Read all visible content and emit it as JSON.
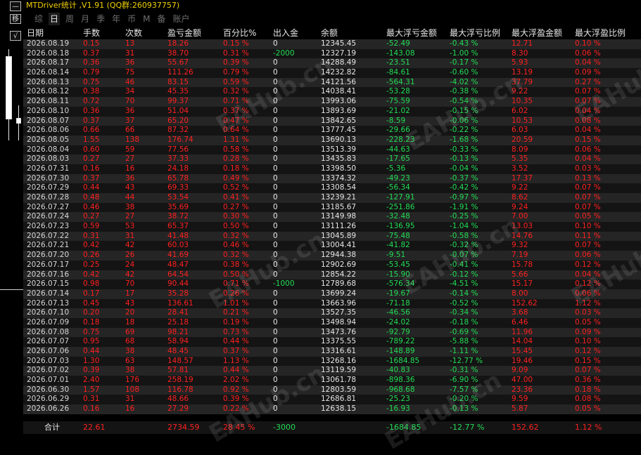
{
  "app": {
    "title": "MTDriver统计 ,V1.91 (QQ群:260937757)",
    "side_buttons": [
      "—",
      "移",
      "√"
    ]
  },
  "tabs": [
    "综",
    "日",
    "周",
    "月",
    "季",
    "年",
    "币",
    "M",
    "备",
    "账户"
  ],
  "active_tab_index": 1,
  "table": {
    "headers": [
      "日期",
      "手数",
      "次数",
      "盈亏金额",
      "百分比%",
      "出入金",
      "余额",
      "最大浮亏金额",
      "最大浮亏比例",
      "最大浮盈金额",
      "最大浮盈比例"
    ],
    "rows": [
      [
        "2026.08.19",
        "0.15",
        "13",
        "18.26",
        "0.15 %",
        "0",
        "12345.45",
        "-52.49",
        "-0.43 %",
        "12.71",
        "0.10 %"
      ],
      [
        "2026.08.18",
        "0.37",
        "31",
        "38.70",
        "0.31 %",
        "-2000",
        "12327.19",
        "-143.08",
        "-1.00 %",
        "8.30",
        "0.06 %"
      ],
      [
        "2026.08.17",
        "0.36",
        "36",
        "55.67",
        "0.39 %",
        "0",
        "14288.49",
        "-23.51",
        "-0.17 %",
        "5.93",
        "0.04 %"
      ],
      [
        "2026.08.14",
        "0.79",
        "75",
        "111.26",
        "0.79 %",
        "0",
        "14232.82",
        "-84.61",
        "-0.60 %",
        "13.19",
        "0.09 %"
      ],
      [
        "2026.08.13",
        "0.75",
        "46",
        "83.15",
        "0.59 %",
        "0",
        "14121.56",
        "-564.31",
        "-4.02 %",
        "37.79",
        "0.27 %"
      ],
      [
        "2026.08.12",
        "0.38",
        "34",
        "45.35",
        "0.32 %",
        "0",
        "14038.41",
        "-53.28",
        "-0.38 %",
        "9.22",
        "0.07 %"
      ],
      [
        "2026.08.11",
        "0.72",
        "70",
        "99.37",
        "0.71 %",
        "0",
        "13993.06",
        "-75.59",
        "-0.54 %",
        "10.35",
        "0.07 %"
      ],
      [
        "2026.08.10",
        "0.36",
        "36",
        "51.04",
        "0.37 %",
        "0",
        "13893.69",
        "-21.02",
        "-0.15 %",
        "6.02",
        "0.04 %"
      ],
      [
        "2026.08.07",
        "0.37",
        "37",
        "65.20",
        "0.47 %",
        "0",
        "13842.65",
        "-8.59",
        "-0.06 %",
        "10.53",
        "0.08 %"
      ],
      [
        "2026.08.06",
        "0.66",
        "66",
        "87.32",
        "0.64 %",
        "0",
        "13777.45",
        "-29.66",
        "-0.22 %",
        "6.03",
        "0.04 %"
      ],
      [
        "2026.08.05",
        "1.55",
        "138",
        "176.74",
        "1.31 %",
        "0",
        "13690.13",
        "-228.23",
        "-1.68 %",
        "20.59",
        "0.15 %"
      ],
      [
        "2026.08.04",
        "0.60",
        "59",
        "77.56",
        "0.58 %",
        "0",
        "13513.39",
        "-44.63",
        "-0.33 %",
        "8.09",
        "0.06 %"
      ],
      [
        "2026.08.03",
        "0.27",
        "27",
        "37.33",
        "0.28 %",
        "0",
        "13435.83",
        "-17.65",
        "-0.13 %",
        "5.35",
        "0.04 %"
      ],
      [
        "2026.07.31",
        "0.16",
        "16",
        "24.18",
        "0.18 %",
        "0",
        "13398.50",
        "-5.36",
        "-0.04 %",
        "3.52",
        "0.03 %"
      ],
      [
        "2026.07.30",
        "0.37",
        "36",
        "65.78",
        "0.49 %",
        "0",
        "13374.32",
        "-49.23",
        "-0.37 %",
        "17.37",
        "0.13 %"
      ],
      [
        "2026.07.29",
        "0.44",
        "43",
        "69.33",
        "0.52 %",
        "0",
        "13308.54",
        "-56.34",
        "-0.42 %",
        "9.22",
        "0.07 %"
      ],
      [
        "2026.07.28",
        "0.48",
        "44",
        "53.54",
        "0.41 %",
        "0",
        "13239.21",
        "-127.91",
        "-0.97 %",
        "8.62",
        "0.07 %"
      ],
      [
        "2026.07.27",
        "0.46",
        "38",
        "35.69",
        "0.27 %",
        "0",
        "13185.67",
        "-251.86",
        "-1.91 %",
        "9.24",
        "0.07 %"
      ],
      [
        "2026.07.24",
        "0.27",
        "27",
        "38.72",
        "0.30 %",
        "0",
        "13149.98",
        "-32.48",
        "-0.25 %",
        "7.00",
        "0.05 %"
      ],
      [
        "2026.07.23",
        "0.59",
        "53",
        "65.37",
        "0.50 %",
        "0",
        "13111.26",
        "-136.95",
        "-1.04 %",
        "13.03",
        "0.10 %"
      ],
      [
        "2026.07.22",
        "0.31",
        "31",
        "41.48",
        "0.32 %",
        "0",
        "13045.89",
        "-75.48",
        "-0.58 %",
        "14.76",
        "0.11 %"
      ],
      [
        "2026.07.21",
        "0.42",
        "42",
        "60.03",
        "0.46 %",
        "0",
        "13004.41",
        "-41.82",
        "-0.32 %",
        "9.32",
        "0.07 %"
      ],
      [
        "2026.07.20",
        "0.26",
        "26",
        "41.69",
        "0.32 %",
        "0",
        "12944.38",
        "-9.51",
        "-0.07 %",
        "7.19",
        "0.06 %"
      ],
      [
        "2026.07.17",
        "0.25",
        "24",
        "48.47",
        "0.38 %",
        "0",
        "12902.69",
        "-53.45",
        "-0.41 %",
        "15.78",
        "0.12 %"
      ],
      [
        "2026.07.16",
        "0.42",
        "42",
        "64.54",
        "0.50 %",
        "0",
        "12854.22",
        "-15.90",
        "-0.12 %",
        "5.66",
        "0.04 %"
      ],
      [
        "2026.07.15",
        "0.98",
        "70",
        "90.44",
        "0.71 %",
        "-1000",
        "12789.68",
        "-576.34",
        "-4.51 %",
        "15.17",
        "0.12 %"
      ],
      [
        "2026.07.14",
        "0.17",
        "17",
        "35.28",
        "0.26 %",
        "0",
        "13699.24",
        "-19.67",
        "-0.14 %",
        "8.00",
        "0.06 %"
      ],
      [
        "2026.07.13",
        "0.45",
        "43",
        "136.61",
        "1.01 %",
        "0",
        "13663.96",
        "-71.18",
        "-0.52 %",
        "152.62",
        "1.12 %"
      ],
      [
        "2026.07.10",
        "0.20",
        "20",
        "28.41",
        "0.21 %",
        "0",
        "13527.35",
        "-46.56",
        "-0.34 %",
        "3.68",
        "0.03 %"
      ],
      [
        "2026.07.09",
        "0.18",
        "18",
        "25.18",
        "0.19 %",
        "0",
        "13498.94",
        "-24.02",
        "-0.18 %",
        "6.46",
        "0.05 %"
      ],
      [
        "2026.07.08",
        "0.75",
        "69",
        "98.21",
        "0.73 %",
        "0",
        "13473.76",
        "-92.79",
        "-0.69 %",
        "11.96",
        "0.09 %"
      ],
      [
        "2026.07.07",
        "0.95",
        "68",
        "58.94",
        "0.44 %",
        "0",
        "13375.55",
        "-789.22",
        "-5.88 %",
        "14.04",
        "0.10 %"
      ],
      [
        "2026.07.06",
        "0.44",
        "38",
        "48.45",
        "0.37 %",
        "0",
        "13316.61",
        "-148.89",
        "-1.11 %",
        "15.45",
        "0.12 %"
      ],
      [
        "2026.07.03",
        "1.30",
        "63",
        "148.57",
        "1.13 %",
        "0",
        "13268.16",
        "-1684.85",
        "-12.77 %",
        "19.46",
        "0.15 %"
      ],
      [
        "2026.07.02",
        "0.39",
        "38",
        "57.81",
        "0.44 %",
        "0",
        "13119.59",
        "-40.83",
        "-0.31 %",
        "9.09",
        "0.07 %"
      ],
      [
        "2026.07.01",
        "2.40",
        "176",
        "258.19",
        "2.02 %",
        "0",
        "13061.78",
        "-898.36",
        "-6.90 %",
        "47.00",
        "0.36 %"
      ],
      [
        "2026.06.30",
        "1.57",
        "108",
        "116.78",
        "0.92 %",
        "0",
        "12803.59",
        "-968.68",
        "-7.57 %",
        "23.36",
        "0.18 %"
      ],
      [
        "2026.06.29",
        "0.31",
        "31",
        "48.66",
        "0.39 %",
        "0",
        "12686.81",
        "-25.23",
        "-0.20 %",
        "9.59",
        "0.08 %"
      ],
      [
        "2026.06.26",
        "0.16",
        "16",
        "27.29",
        "0.22 %",
        "0",
        "12638.15",
        "-16.93",
        "-0.13 %",
        "5.87",
        "0.05 %"
      ]
    ],
    "total": [
      "合计",
      "22.61",
      "",
      "2734.59",
      "28.45 %",
      "-3000",
      "",
      "-1684.85",
      "-12.77 %",
      "152.62",
      "1.12 %"
    ]
  },
  "watermark_text": "EAHub.cn",
  "colors": {
    "positive": "#ff2020",
    "negative": "#22dd55",
    "neutral": "#e6e6e6",
    "title": "#f0d000"
  }
}
